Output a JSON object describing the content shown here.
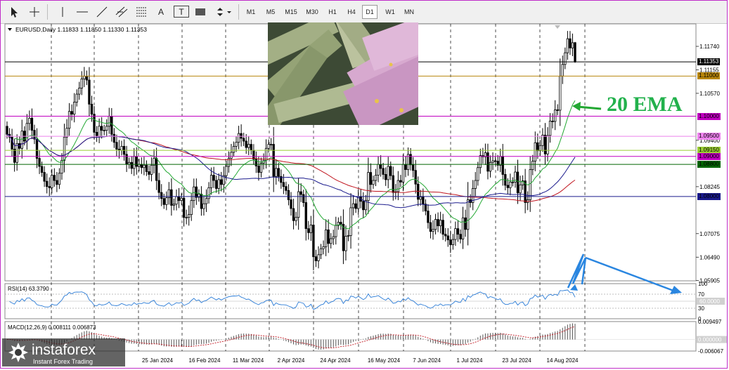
{
  "toolbar": {
    "timeframes": [
      "M1",
      "M5",
      "M15",
      "M30",
      "H1",
      "H4",
      "D1",
      "W1",
      "MN"
    ],
    "active_timeframe": "D1",
    "tool_icons": [
      "cursor-icon",
      "crosshair-icon",
      "vertical-line-icon",
      "horizontal-line-icon",
      "trendline-icon",
      "channel-icon",
      "fibonacci-icon",
      "text-icon",
      "text-label-icon",
      "rectangle-icon",
      "arrows-icon"
    ],
    "tool_letters": [
      "A",
      "T"
    ]
  },
  "chart_header": "EURUSD,Daily  1.11833 1.11850 1.11330 1.11353",
  "annotation": "20 EMA",
  "logo": {
    "brand": "instaforex",
    "tagline": "Instant Forex Trading"
  },
  "colors": {
    "bull": "#000000",
    "bear": "#000000",
    "ema20": "#22a832",
    "ma_red": "#c0141e",
    "ma_blue": "#1a1a8c",
    "rsi": "#2a7bd6",
    "macd_hist": "#555555",
    "macd_signal": "#c0141e",
    "arrow": "#2a86e0",
    "frame": "#c02cc8"
  },
  "chart_data": [
    {
      "type": "candlestick",
      "symbol": "EURUSD",
      "timeframe": "Daily",
      "ohlc_last": {
        "open": 1.11833,
        "high": 1.1185,
        "low": 1.1133,
        "close": 1.11353
      },
      "ylim": [
        1.059,
        1.123
      ],
      "y_ticks": [
        1.1174,
        1.11155,
        1.1057,
        1.094,
        1.08245,
        1.07075,
        1.0649,
        1.05905
      ],
      "y_tick_labels": [
        "1.11740",
        "1.11155",
        "1.10570",
        "1.09400",
        "1.08245",
        "1.07075",
        "1.06490",
        "1.05905"
      ],
      "x_labels": [
        "25 Jan 2024",
        "16 Feb 2024",
        "11 Mar 2024",
        "2 Apr 2024",
        "24 Apr 2024",
        "16 May 2024",
        "7 Jun 2024",
        "1 Jul 2024",
        "23 Jul 2024",
        "14 Aug 2024"
      ],
      "closes": [
        1.0955,
        1.0948,
        1.0918,
        1.0885,
        1.0932,
        1.092,
        1.0963,
        1.0938,
        1.0982,
        1.0995,
        1.0965,
        1.0943,
        1.0895,
        1.0875,
        1.086,
        1.0838,
        1.0825,
        1.0822,
        1.0853,
        1.084,
        1.083,
        1.0858,
        1.089,
        1.0948,
        1.097,
        1.1012,
        1.1005,
        1.1035,
        1.1055,
        1.107,
        1.1093,
        1.11,
        1.109,
        1.103,
        1.1005,
        1.096,
        1.095,
        1.0975,
        1.0965,
        1.0965,
        1.0975,
        1.1,
        1.0955,
        1.0935,
        1.0918,
        1.0915,
        1.0925,
        1.0905,
        1.088,
        1.0885,
        1.087,
        1.09,
        1.0875,
        1.088,
        1.0872,
        1.0878,
        1.0862,
        1.0855,
        1.0878,
        1.0895,
        1.084,
        1.081,
        1.0795,
        1.078,
        1.0797,
        1.0817,
        1.0778,
        1.0781,
        1.08,
        1.079,
        1.0796,
        1.0748,
        1.0748,
        1.0755,
        1.079,
        1.0824,
        1.0798,
        1.0806,
        1.077,
        1.0782,
        1.0795,
        1.0822,
        1.0853,
        1.084,
        1.082,
        1.0842,
        1.083,
        1.0852,
        1.0875,
        1.0895,
        1.091,
        1.0925,
        1.0935,
        1.0957,
        1.0945,
        1.0938,
        1.0922,
        1.093,
        1.0915,
        1.0893,
        1.0876,
        1.086,
        1.0883,
        1.089,
        1.092,
        1.093,
        1.093,
        1.085,
        1.087,
        1.085,
        1.0835,
        1.0825,
        1.0815,
        1.0792,
        1.077,
        1.074,
        1.0748,
        1.0812,
        1.0805,
        1.0785,
        1.072,
        1.071,
        1.0729,
        1.065,
        1.064,
        1.0655,
        1.067,
        1.0675,
        1.0717,
        1.0683,
        1.0695,
        1.07,
        1.0728,
        1.0736,
        1.0731,
        1.0665,
        1.0701,
        1.0703,
        1.0772,
        1.0782,
        1.077,
        1.08,
        1.0788,
        1.0767,
        1.079,
        1.086,
        1.083,
        1.084,
        1.0853,
        1.088,
        1.087,
        1.0855,
        1.0842,
        1.0875,
        1.0852,
        1.081,
        1.0812,
        1.084,
        1.0836,
        1.088,
        1.0867,
        1.0905,
        1.0879,
        1.0865,
        1.0831,
        1.0793,
        1.0799,
        1.0781,
        1.0764,
        1.0735,
        1.0713,
        1.0718,
        1.0743,
        1.0727,
        1.0741,
        1.0706,
        1.0702,
        1.0692,
        1.068,
        1.0693,
        1.072,
        1.0706,
        1.0694,
        1.0747,
        1.0718,
        1.0792,
        1.0785,
        1.082,
        1.084,
        1.0872,
        1.0902,
        1.0899,
        1.0909,
        1.0863,
        1.0885,
        1.0889,
        1.0888,
        1.0878,
        1.09,
        1.0855,
        1.0828,
        1.0822,
        1.0836,
        1.0836,
        1.0861,
        1.0809,
        1.0829,
        1.0839,
        1.0785,
        1.0792,
        1.0867,
        1.0888,
        1.0934,
        1.0914,
        1.0927,
        1.0953,
        1.0906,
        1.0952,
        1.0988,
        1.0987,
        1.1016,
        1.1015,
        1.11,
        1.1129,
        1.1158,
        1.1193,
        1.117,
        1.1183,
        1.1135
      ]
    },
    {
      "type": "line",
      "name": "RSI(14) 63.3790",
      "ylim": [
        0,
        100
      ],
      "y_tick_labels": [
        "100",
        "70",
        "50",
        "30",
        "0"
      ],
      "current_label": "60.0000"
    },
    {
      "type": "bar",
      "name": "MACD(12,26,9) 0.008111 0.006873",
      "y_tick_labels": [
        "0.009497",
        "0.000000",
        "-0.006067"
      ]
    }
  ],
  "price_levels": [
    {
      "value": 1.11353,
      "label": "1.11353",
      "color": "#000000",
      "text_color": "#ffffff"
    },
    {
      "value": 1.11,
      "label": "1.11000",
      "color": "#b8860b",
      "text_color": "#000000"
    },
    {
      "value": 1.1,
      "label": "1.10000",
      "color": "#c000c0",
      "text_color": "#000000"
    },
    {
      "value": 1.095,
      "label": "1.09500",
      "color": "#ee82ee",
      "text_color": "#000000"
    },
    {
      "value": 1.0915,
      "label": "1.09150",
      "color": "#9acd32",
      "text_color": "#000000"
    },
    {
      "value": 1.09,
      "label": "1.09000",
      "color": "#c000c0",
      "text_color": "#000000"
    },
    {
      "value": 1.088,
      "label": "1.08800",
      "color": "#006400",
      "text_color": "#000000"
    },
    {
      "value": 1.08,
      "label": "1.08000",
      "color": "#1a1a8c",
      "text_color": "#000000"
    }
  ]
}
